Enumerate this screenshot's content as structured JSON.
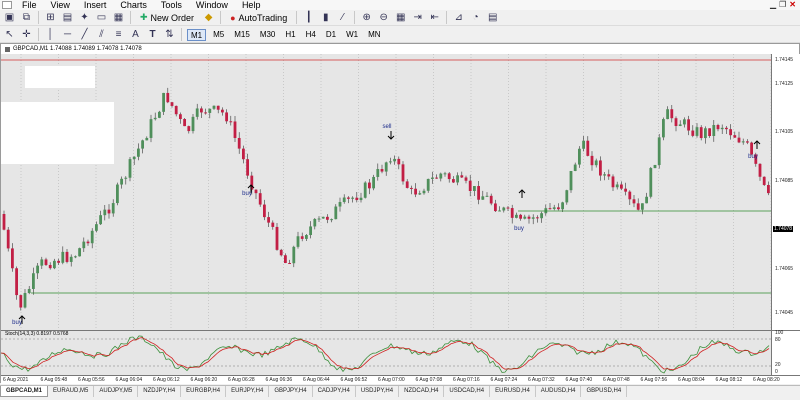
{
  "menu": [
    "File",
    "View",
    "Insert",
    "Charts",
    "Tools",
    "Window",
    "Help"
  ],
  "toolbar": {
    "new_order_label": "New Order",
    "autotrading_label": "AutoTrading",
    "timeframes": [
      "M1",
      "M5",
      "M15",
      "M30",
      "H1",
      "H4",
      "D1",
      "W1",
      "MN"
    ],
    "active_timeframe": "M1",
    "tool_text_label": "A",
    "tool_textlabel_label": "T"
  },
  "chart": {
    "title": "GBPCAD,M1  1.74088 1.74089 1.74078 1.74078",
    "current_price": "1.74078",
    "price_labels": [
      "1.74145",
      "1.74125",
      "1.74105",
      "1.74085",
      "1.74065",
      "1.74045"
    ],
    "oscillator_title": "Stoch(14,3,3) 0.8197 0.5768",
    "oscillator_levels": [
      "100",
      "80",
      "20",
      "0"
    ],
    "annotations": {
      "sell": "sell",
      "buy": "buy"
    },
    "time_labels": [
      "6 Aug 2021",
      "6 Aug 05:48",
      "6 Aug 05:56",
      "6 Aug 06:04",
      "6 Aug 06:12",
      "6 Aug 06:20",
      "6 Aug 06:28",
      "6 Aug 06:36",
      "6 Aug 06:44",
      "6 Aug 06:52",
      "6 Aug 07:00",
      "6 Aug 07:08",
      "6 Aug 07:16",
      "6 Aug 07:24",
      "6 Aug 07:32",
      "6 Aug 07:40",
      "6 Aug 07:48",
      "6 Aug 07:56",
      "6 Aug 08:04",
      "6 Aug 08:12",
      "6 Aug 08:20"
    ],
    "colors": {
      "bull": "#4f8f5b",
      "bear": "#c21f45",
      "level": "#2e8b2e",
      "resistance": "#d03030",
      "plot_bg": "#e6e6e6",
      "stoch_main": "#3b8f3b",
      "stoch_signal": "#d02020"
    }
  },
  "tabs": [
    "GBPCAD,M1",
    "EURAUD,M5",
    "AUDJPY,M5",
    "NZDJPY,H4",
    "EURGBP,H4",
    "EURJPY,H4",
    "GBPJPY,H4",
    "CADJPY,H4",
    "USDJPY,H4",
    "NZDCAD,H4",
    "USDCAD,H4",
    "EURUSD,H4",
    "AUDUSD,H4",
    "GBPUSD,H4"
  ],
  "active_tab": "GBPCAD,M1"
}
